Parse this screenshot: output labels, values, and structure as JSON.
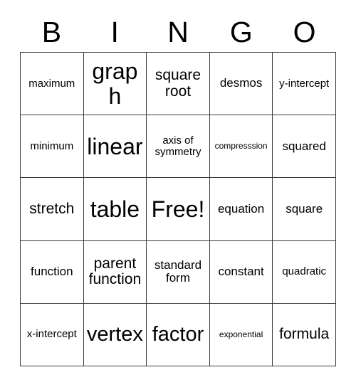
{
  "header": {
    "letters": [
      "B",
      "I",
      "N",
      "G",
      "O"
    ]
  },
  "grid": {
    "rows": 5,
    "columns": 5,
    "border_color": "#3a3a3a",
    "background_color": "#ffffff",
    "text_color": "#000000",
    "cells": [
      [
        {
          "label": "maximum",
          "size": "fs-xs"
        },
        {
          "label": "graph",
          "size": "fs-xl"
        },
        {
          "label": "square root",
          "size": "fs-md"
        },
        {
          "label": "desmos",
          "size": "fs-sm"
        },
        {
          "label": "y-intercept",
          "size": "fs-xs"
        }
      ],
      [
        {
          "label": "minimum",
          "size": "fs-xs"
        },
        {
          "label": "linear",
          "size": "fs-xl"
        },
        {
          "label": "axis of symmetry",
          "size": "fs-xs"
        },
        {
          "label": "compresssion",
          "size": "fs-xxs"
        },
        {
          "label": "squared",
          "size": "fs-sm"
        }
      ],
      [
        {
          "label": "stretch",
          "size": "fs-md"
        },
        {
          "label": "table",
          "size": "fs-xl"
        },
        {
          "label": "Free!",
          "size": "fs-xl"
        },
        {
          "label": "equation",
          "size": "fs-sm"
        },
        {
          "label": "square",
          "size": "fs-sm"
        }
      ],
      [
        {
          "label": "function",
          "size": "fs-sm"
        },
        {
          "label": "parent function",
          "size": "fs-md"
        },
        {
          "label": "standard form",
          "size": "fs-sm"
        },
        {
          "label": "constant",
          "size": "fs-sm"
        },
        {
          "label": "quadratic",
          "size": "fs-xs"
        }
      ],
      [
        {
          "label": "x-intercept",
          "size": "fs-xs"
        },
        {
          "label": "vertex",
          "size": "fs-lg"
        },
        {
          "label": "factor",
          "size": "fs-lg"
        },
        {
          "label": "exponential",
          "size": "fs-xxs"
        },
        {
          "label": "formula",
          "size": "fs-md"
        }
      ]
    ]
  }
}
